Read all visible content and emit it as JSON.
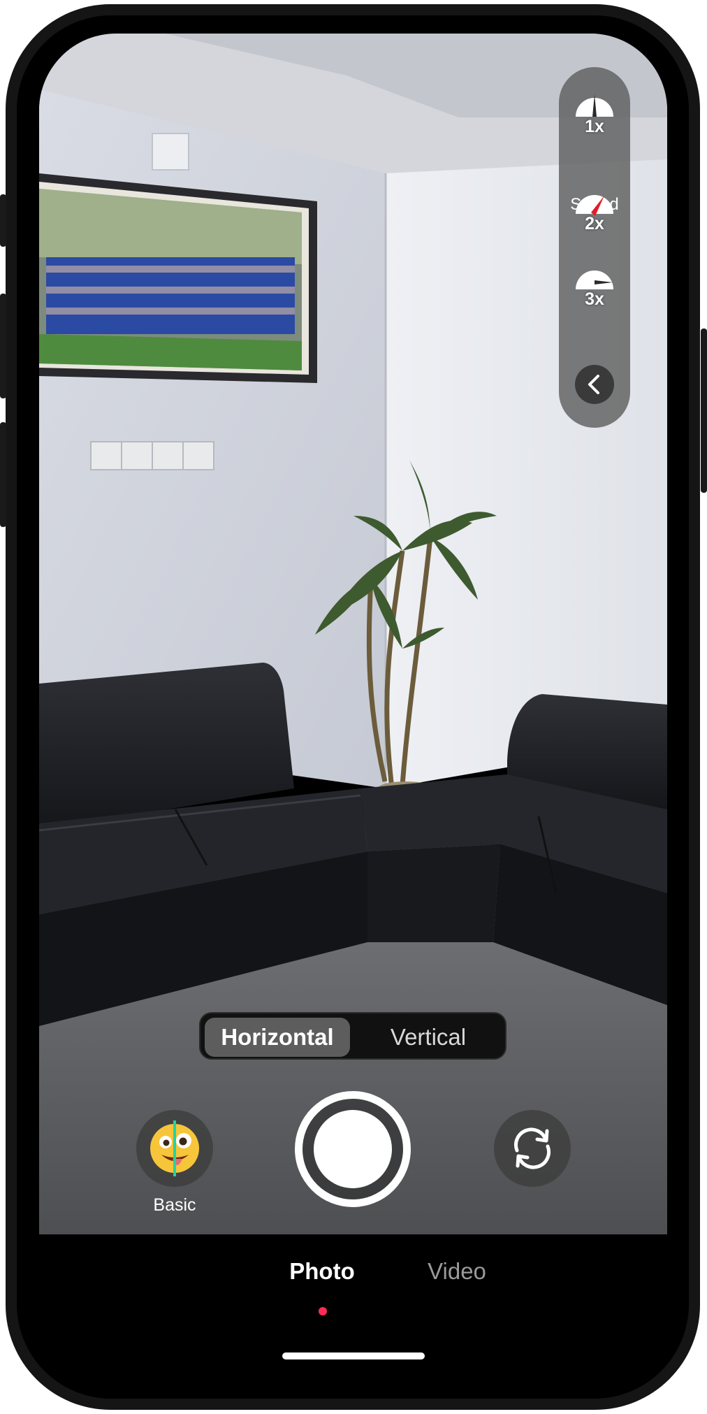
{
  "speed_panel": {
    "label": "Speed",
    "options": [
      {
        "multiplier": "1x",
        "icon": "speedometer-low-icon",
        "selected": false
      },
      {
        "multiplier": "2x",
        "icon": "speedometer-medium-icon",
        "selected": true
      },
      {
        "multiplier": "3x",
        "icon": "speedometer-high-icon",
        "selected": false
      }
    ],
    "collapse_icon": "chevron-left-icon"
  },
  "orientation": {
    "options": [
      "Horizontal",
      "Vertical"
    ],
    "selected": "Horizontal"
  },
  "controls": {
    "filter_label": "Basic",
    "filter_icon": "emoji-face-icon",
    "shutter_icon": "shutter-button",
    "flip_icon": "camera-flip-icon"
  },
  "modes": {
    "photo": "Photo",
    "video": "Video",
    "selected": "Photo"
  },
  "colors": {
    "accent": "#ff2d55",
    "gauge_needle": "#e01e2a",
    "split_line": "#22d3a5"
  }
}
